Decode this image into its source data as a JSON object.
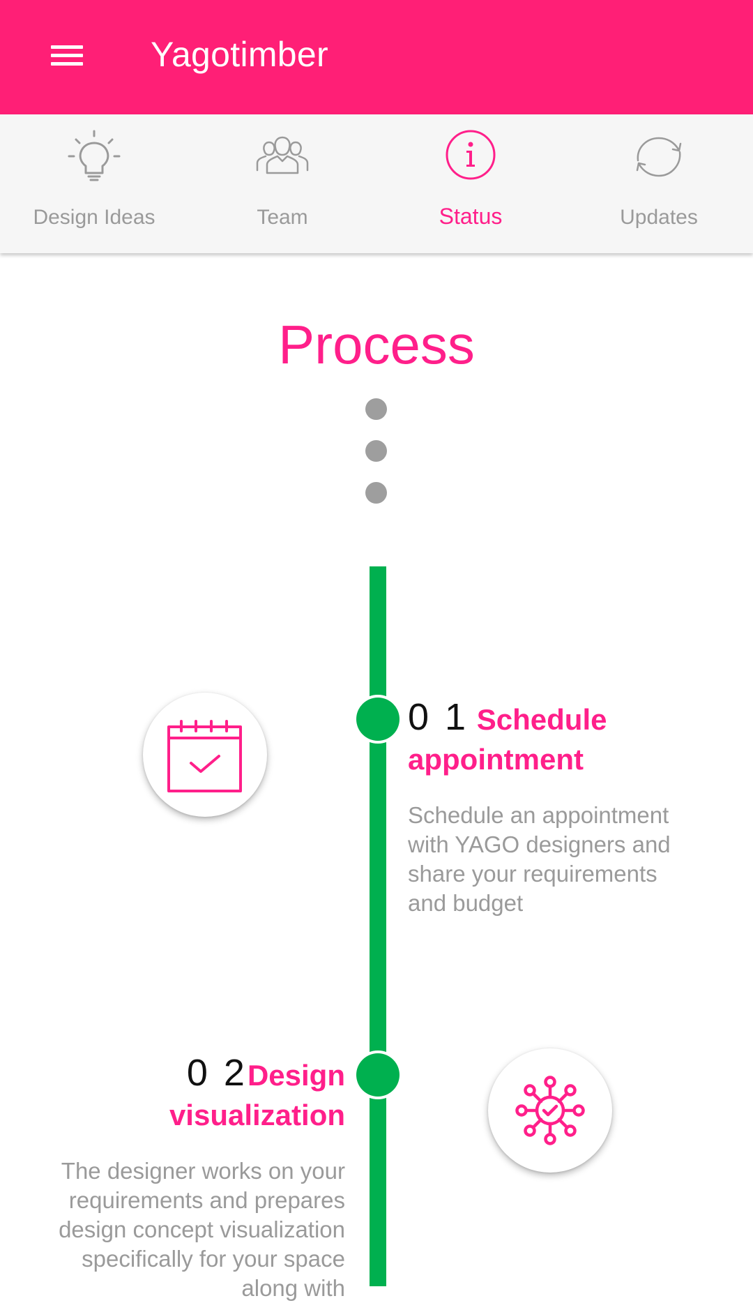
{
  "app": {
    "title": "Yagotimber",
    "menu_icon": "hamburger-menu-icon"
  },
  "tabs": [
    {
      "label": "Design Ideas",
      "icon": "lightbulb-icon",
      "active": false
    },
    {
      "label": "Team",
      "icon": "team-icon",
      "active": false
    },
    {
      "label": "Status",
      "icon": "info-icon",
      "active": true
    },
    {
      "label": "Updates",
      "icon": "refresh-icon",
      "active": false
    }
  ],
  "content": {
    "title": "Process",
    "steps": [
      {
        "number": "0 1",
        "title": "Schedule appointment",
        "description": "Schedule an appointment with YAGO designers and share your requirements and budget",
        "icon": "calendar-check-icon"
      },
      {
        "number": "0 2",
        "title": "Design visualization",
        "description": "The designer works on your requirements and prepares design concept visualization specifically for your space along with",
        "icon": "network-check-icon"
      }
    ]
  },
  "colors": {
    "primary": "#FF1F76",
    "accent_text": "#FF1F8A",
    "timeline": "#00B04F",
    "inactive": "#9A9A9A",
    "tab_background": "#F6F6F6"
  }
}
